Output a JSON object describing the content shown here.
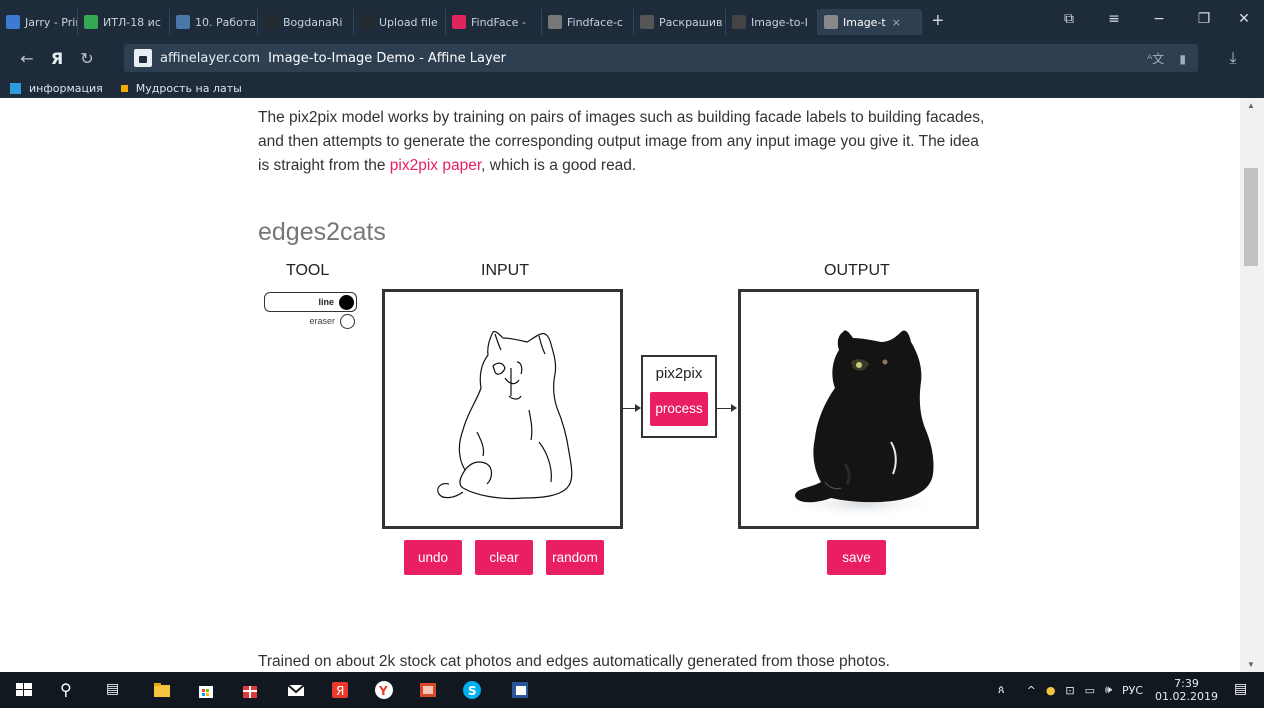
{
  "browser": {
    "tabs": [
      {
        "label": "Jarry - Prin",
        "color": "#3b7bd4"
      },
      {
        "label": "ИТЛ-18 ис",
        "color": "#34a853"
      },
      {
        "label": "10. Работа",
        "color": "#4a76a8"
      },
      {
        "label": "BogdanaRi",
        "color": "#24292e"
      },
      {
        "label": "Upload file",
        "color": "#24292e"
      },
      {
        "label": "FindFace -",
        "color": "#e0245e"
      },
      {
        "label": "Findface-c",
        "color": "#777777"
      },
      {
        "label": "Раскрашив",
        "color": "#555555"
      },
      {
        "label": "Image-to-I",
        "color": "#444444"
      },
      {
        "label": "Image-t",
        "color": "#888888"
      }
    ],
    "new_tab": "+",
    "url_domain": "affinelayer.com",
    "url_title": "Image-to-Image Demo - Affine Layer",
    "bookmarks": [
      {
        "label": "информация",
        "color": "#2d9cdb"
      },
      {
        "label": "Мудрость на латы",
        "color": "#f2a900"
      }
    ]
  },
  "page": {
    "intro_pre": "The pix2pix model works by training on pairs of images such as building facade labels to building facades, and then attempts to generate the corresponding output image from any input image you give it. The idea is straight from the ",
    "intro_link": "pix2pix paper",
    "intro_post": ", which is a good read.",
    "section_title": "edges2cats",
    "tool_label": "TOOL",
    "input_label": "INPUT",
    "output_label": "OUTPUT",
    "tool_line": "line",
    "tool_eraser": "eraser",
    "model_name": "pix2pix",
    "process_button": "process",
    "undo_button": "undo",
    "clear_button": "clear",
    "random_button": "random",
    "save_button": "save",
    "footer_text": "Trained on about 2k stock cat photos and edges automatically generated from those photos."
  },
  "taskbar": {
    "language": "РУС",
    "time": "7:39",
    "date": "01.02.2019"
  },
  "colors": {
    "accent": "#e91e63",
    "chrome": "#1e2b3a"
  }
}
